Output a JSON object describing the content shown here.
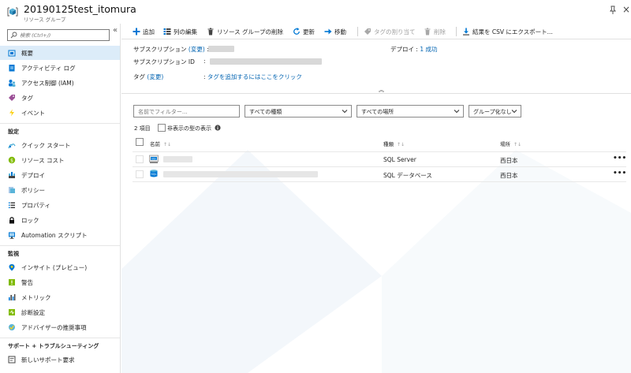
{
  "header": {
    "title": "20190125test_itomura",
    "subtitle": "リソース グループ"
  },
  "sidebar": {
    "search_placeholder": "検索 (Ctrl+/)",
    "collapse_glyph": "«",
    "items_top": [
      {
        "label": "概要",
        "icon": "resource-group-icon",
        "active": true
      },
      {
        "label": "アクティビティ ログ",
        "icon": "activity-log-icon"
      },
      {
        "label": "アクセス制御 (IAM)",
        "icon": "iam-icon"
      },
      {
        "label": "タグ",
        "icon": "tag-icon"
      },
      {
        "label": "イベント",
        "icon": "events-icon"
      }
    ],
    "section_settings": "設定",
    "items_settings": [
      {
        "label": "クイック スタート",
        "icon": "quickstart-icon"
      },
      {
        "label": "リソース コスト",
        "icon": "cost-icon"
      },
      {
        "label": "デプロイ",
        "icon": "deployments-icon"
      },
      {
        "label": "ポリシー",
        "icon": "policy-icon"
      },
      {
        "label": "プロパティ",
        "icon": "properties-icon"
      },
      {
        "label": "ロック",
        "icon": "lock-icon"
      },
      {
        "label": "Automation スクリプト",
        "icon": "automation-icon"
      }
    ],
    "section_monitoring": "監視",
    "items_monitoring": [
      {
        "label": "インサイト (プレビュー)",
        "icon": "insights-icon"
      },
      {
        "label": "警告",
        "icon": "alerts-icon"
      },
      {
        "label": "メトリック",
        "icon": "metrics-icon"
      },
      {
        "label": "診断設定",
        "icon": "diagnostics-icon"
      },
      {
        "label": "アドバイザーの推奨事項",
        "icon": "advisor-icon"
      }
    ],
    "section_support": "サポート + トラブルシューティング",
    "items_support": [
      {
        "label": "新しいサポート要求",
        "icon": "support-icon"
      }
    ]
  },
  "toolbar": {
    "add": "追加",
    "edit_columns": "列の編集",
    "delete_group": "リソース グループの削除",
    "refresh": "更新",
    "move": "移動",
    "assign_tags": "タグの割り当て",
    "delete": "削除",
    "export_csv": "結果を CSV にエクスポート..."
  },
  "essentials": {
    "subscription_label": "サブスクリプション",
    "change_link": "(変更)",
    "colon": ":",
    "subscription_id_label": "サブスクリプション ID",
    "deploy_label": "デプロイ",
    "deploy_value": "1 成功",
    "tags_label": "タグ",
    "add_tags_link": "タグを追加するにはここをクリック",
    "collapse_glyph": "︽"
  },
  "filters": {
    "name_placeholder": "名前でフィルター...",
    "type": "すべての種類",
    "location": "すべての場所",
    "grouping": "グループ化なし"
  },
  "list": {
    "count": "2 項目",
    "show_hidden": "非表示の型の表示",
    "columns": {
      "name": "名前",
      "type": "種類",
      "location": "場所"
    },
    "sort_glyph": "↑↓",
    "more_glyph": "•••",
    "rows": [
      {
        "type": "SQL Server",
        "location": "西日本",
        "icon": "sql-server-icon"
      },
      {
        "type": "SQL データベース",
        "location": "西日本",
        "icon": "sql-database-icon"
      }
    ]
  },
  "colors": {
    "accent": "#0063b1",
    "active_bg": "#dcecf9",
    "blue_icon": "#0078d4"
  }
}
